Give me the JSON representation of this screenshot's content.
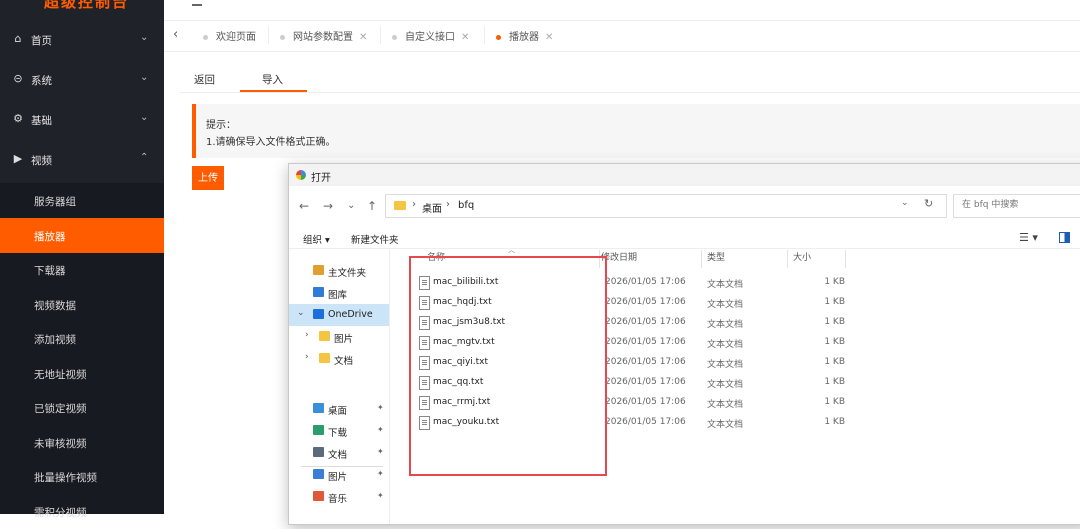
{
  "app": {
    "brand": "超级控制台"
  },
  "sidebar": {
    "top_items": [
      {
        "label": "首页",
        "icon": "home-icon",
        "glyph": "⌂",
        "chev": "⌄"
      },
      {
        "label": "系统",
        "icon": "system-icon",
        "glyph": "⊝",
        "chev": "⌄"
      },
      {
        "label": "基础",
        "icon": "gear-icon",
        "glyph": "⚙",
        "chev": "⌄"
      },
      {
        "label": "视频",
        "icon": "video-icon",
        "glyph": "▶",
        "chev": "⌃"
      }
    ],
    "sub_items": [
      {
        "label": "服务器组",
        "active": false
      },
      {
        "label": "播放器",
        "active": true
      },
      {
        "label": "下载器",
        "active": false
      },
      {
        "label": "视频数据",
        "active": false
      },
      {
        "label": "添加视频",
        "active": false
      },
      {
        "label": "无地址视频",
        "active": false
      },
      {
        "label": "已锁定视频",
        "active": false
      },
      {
        "label": "未审核视频",
        "active": false
      },
      {
        "label": "批量操作视频",
        "active": false
      },
      {
        "label": "需积分视频",
        "active": false
      }
    ]
  },
  "tabs": {
    "items": [
      {
        "label": "欢迎页面",
        "closable": false
      },
      {
        "label": "网站参数配置",
        "closable": true
      },
      {
        "label": "自定义接口",
        "closable": true
      },
      {
        "label": "播放器",
        "closable": true,
        "active": true
      }
    ],
    "close_glyph": "✕",
    "left_arrow": "‹"
  },
  "page": {
    "tabs": [
      "返回",
      "导入"
    ],
    "active_tab": "导入",
    "tips_title": "提示：",
    "tips_line1": "1.请确保导入文件格式正确。",
    "upload_label": "上传"
  },
  "dialog": {
    "title": "打开",
    "nav": {
      "back": "←",
      "forward": "→",
      "recent": "⌄",
      "up": "↑"
    },
    "address": [
      "桌面",
      "bfq"
    ],
    "address_sep": "›",
    "address_dropdown": "⌄",
    "refresh": "↻",
    "search_placeholder": "在 bfq 中搜索",
    "commands": {
      "organize": "组织 ▾",
      "new_folder": "新建文件夹"
    },
    "view_icon": "☰ ▾",
    "tree": [
      {
        "label": "主文件夹",
        "icon": "home-folder-icon",
        "color": "#e0a030",
        "pinned": false
      },
      {
        "label": "图库",
        "icon": "gallery-icon",
        "color": "#2f7bd6",
        "pinned": false
      },
      {
        "label": "OneDrive",
        "icon": "onedrive-icon",
        "color": "#1e6fd9",
        "expanded": true,
        "selected": true
      },
      {
        "label": "图片",
        "icon": "folder-icon",
        "color": "#f4c542",
        "child": true
      },
      {
        "label": "文档",
        "icon": "folder-icon",
        "color": "#f4c542",
        "child": true
      },
      {
        "label": "桌面",
        "icon": "desktop-icon",
        "color": "#3a8fd9",
        "pinned": true
      },
      {
        "label": "下载",
        "icon": "download-icon",
        "color": "#2a9d6a",
        "pinned": true
      },
      {
        "label": "文档",
        "icon": "document-icon",
        "color": "#5a6b7b",
        "pinned": true
      },
      {
        "label": "图片",
        "icon": "picture-icon",
        "color": "#3a7fd6",
        "pinned": true
      },
      {
        "label": "音乐",
        "icon": "music-icon",
        "color": "#e0583a",
        "pinned": true
      }
    ],
    "pin_glyph": "📌",
    "columns": {
      "name": "名称",
      "date": "修改日期",
      "type": "类型",
      "size": "大小"
    },
    "files": [
      {
        "name": "mac_bilibili.txt",
        "date": "2026/01/05 17:06",
        "type": "文本文档",
        "size": "1 KB"
      },
      {
        "name": "mac_hqdj.txt",
        "date": "2026/01/05 17:06",
        "type": "文本文档",
        "size": "1 KB"
      },
      {
        "name": "mac_jsm3u8.txt",
        "date": "2026/01/05 17:06",
        "type": "文本文档",
        "size": "1 KB"
      },
      {
        "name": "mac_mgtv.txt",
        "date": "2026/01/05 17:06",
        "type": "文本文档",
        "size": "1 KB"
      },
      {
        "name": "mac_qiyi.txt",
        "date": "2026/01/05 17:06",
        "type": "文本文档",
        "size": "1 KB"
      },
      {
        "name": "mac_qq.txt",
        "date": "2026/01/05 17:06",
        "type": "文本文档",
        "size": "1 KB"
      },
      {
        "name": "mac_rrmj.txt",
        "date": "2026/01/05 17:06",
        "type": "文本文档",
        "size": "1 KB"
      },
      {
        "name": "mac_youku.txt",
        "date": "2026/01/05 17:06",
        "type": "文本文档",
        "size": "1 KB"
      }
    ]
  },
  "colors": {
    "accent": "#ff5c00",
    "sidebar_bg": "#20222a",
    "highlight": "#e5484d"
  }
}
